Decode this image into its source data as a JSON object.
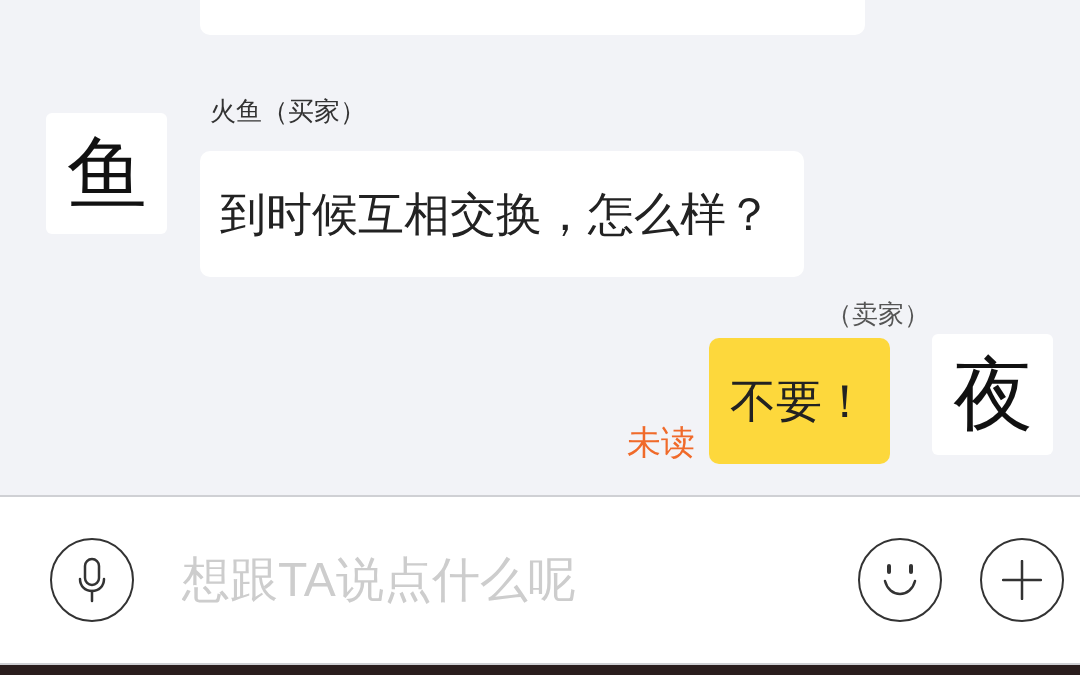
{
  "messages": [
    {
      "kind": "partial"
    },
    {
      "kind": "incoming",
      "sender": "火鱼（买家）",
      "avatar": "鱼",
      "text": "到时候互相交换，怎么样？"
    },
    {
      "kind": "outgoing",
      "sender": "（卖家）",
      "avatar": "夜",
      "text": "不要！",
      "status": "未读"
    }
  ],
  "input_bar": {
    "placeholder": "想跟TA说点什么呢"
  }
}
